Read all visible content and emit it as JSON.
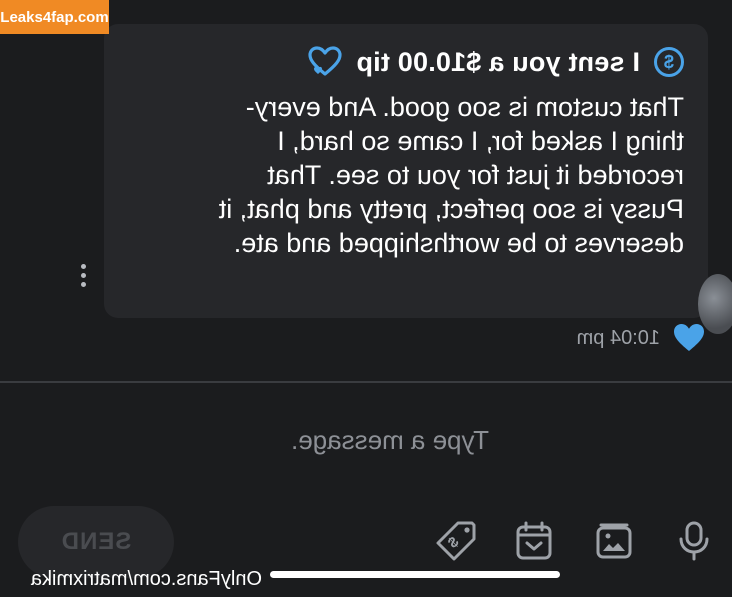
{
  "site_badge": "Leaks4fap.com",
  "message": {
    "tip_label": "I sent you a $10.00 tip",
    "tip_currency_symbol": "$",
    "body": "That custom is soo good. And every-\nthing I asked for, I came so hard, I\nrecorded it just for you to see. That\nPussy is soo perfect, pretty and phat, it\ndeserves to be worthshipped and ate.",
    "time": "10:04 pm",
    "liked": true
  },
  "composer": {
    "placeholder": "Type a message...",
    "send_label": "SEND",
    "tools": [
      "mic-icon",
      "media-icon",
      "schedule-icon",
      "price-tag-icon"
    ]
  },
  "watermark": "OnlyFans.com/matrixmika",
  "colors": {
    "background": "#1b1c1e",
    "bubble": "#26272a",
    "accent": "#4aa3e8",
    "badge": "#f08a24"
  }
}
